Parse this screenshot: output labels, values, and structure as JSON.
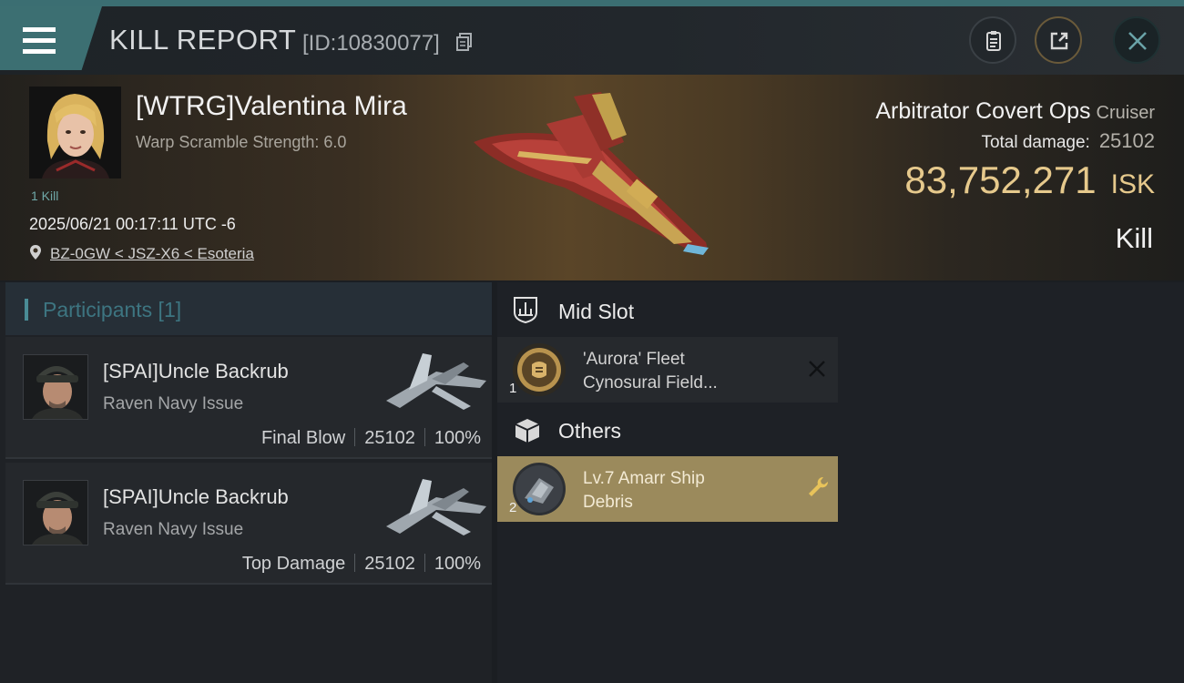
{
  "header": {
    "title": "KILL REPORT",
    "report_id": "[ID:10830077]",
    "icons": [
      "menu-icon",
      "copy-icon",
      "clipboard-icon",
      "share-icon",
      "close-icon"
    ]
  },
  "victim": {
    "name": "[WTRG]Valentina Mira",
    "warp_scramble": "Warp Scramble Strength: 6.0",
    "kill_count": "1 Kill",
    "datetime": "2025/06/21 00:17:11 UTC -6",
    "location": "BZ-0GW < JSZ-X6 < Esoteria",
    "ship_name": "Arbitrator Covert Ops",
    "ship_class": "Cruiser",
    "total_damage_label": "Total damage:",
    "total_damage": "25102",
    "isk_value": "83,752,271",
    "isk_unit": "ISK",
    "result": "Kill"
  },
  "participants": {
    "header": "Participants [1]",
    "rows": [
      {
        "name": "[SPAI]Uncle Backrub",
        "ship": "Raven Navy Issue",
        "role": "Final Blow",
        "damage": "25102",
        "percent": "100%"
      },
      {
        "name": "[SPAI]Uncle Backrub",
        "ship": "Raven Navy Issue",
        "role": "Top Damage",
        "damage": "25102",
        "percent": "100%"
      }
    ]
  },
  "modules": {
    "mid_slot": {
      "label": "Mid Slot",
      "item": {
        "line1": "'Aurora' Fleet",
        "line2": "Cynosural Field...",
        "qty": "1"
      }
    },
    "others": {
      "label": "Others",
      "item": {
        "line1": "Lv.7 Amarr Ship",
        "line2": "Debris",
        "qty": "2"
      }
    }
  },
  "colors": {
    "accent_teal": "#3c6f72",
    "isk_gold": "#e6c98c",
    "highlight_item": "#9b8a5c"
  }
}
